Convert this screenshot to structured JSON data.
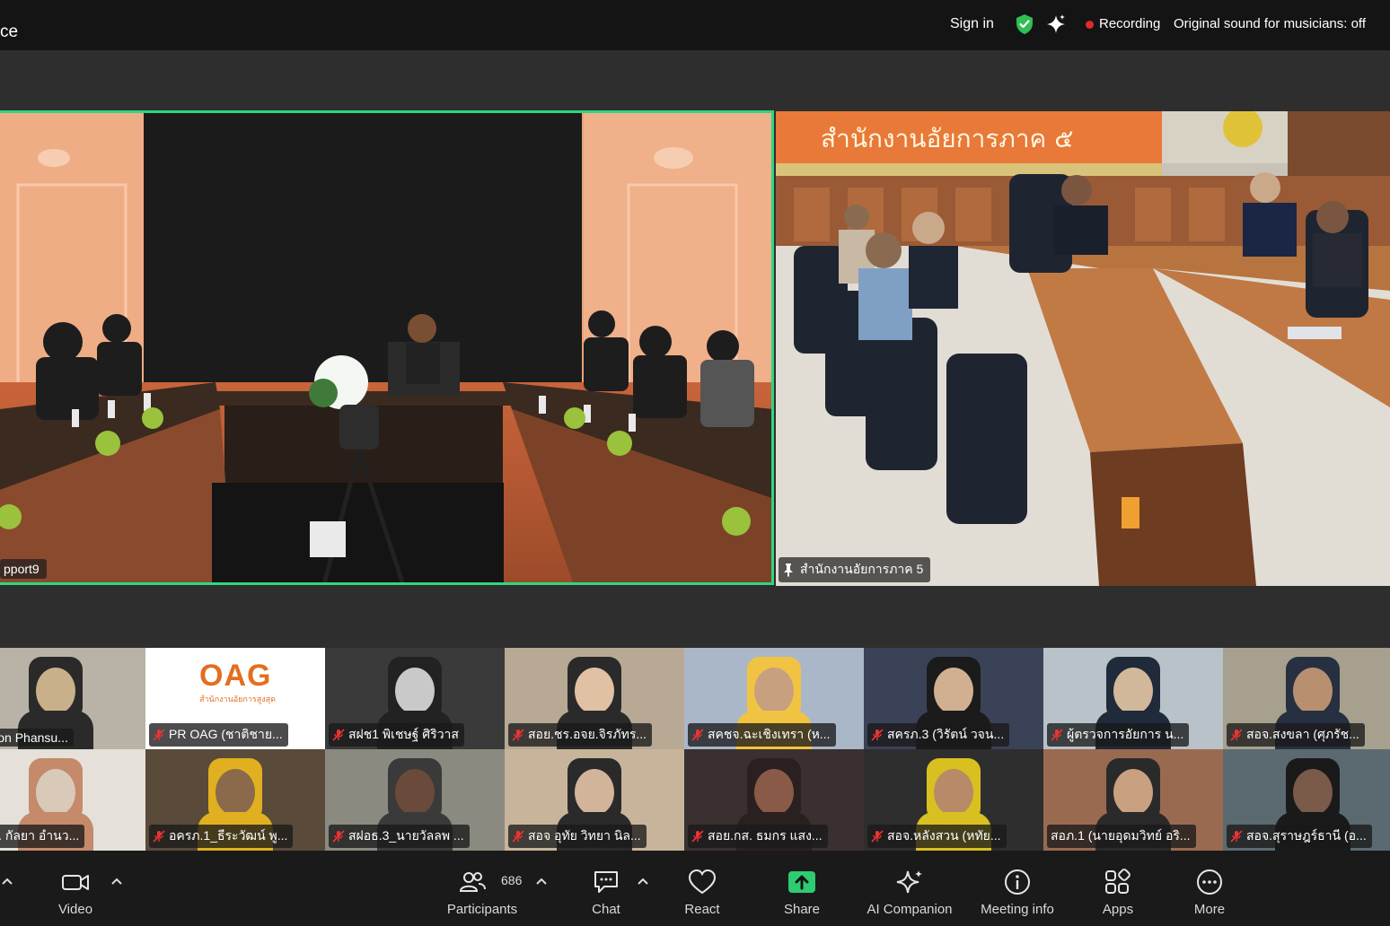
{
  "topbar": {
    "title_fragment": "ce",
    "sign_in": "Sign in",
    "recording": "Recording",
    "original_sound": "Original sound for musicians: off",
    "shield_color": "#2fbf52"
  },
  "main_video": {
    "name": "pport9",
    "border_color": "#2fd67f"
  },
  "right_video": {
    "name": "สำนักงานอัยการภาค 5",
    "banner": "สำนักงานอัยการภาค ๕"
  },
  "gallery": [
    {
      "label": "umpon Phansu...",
      "muted": false
    },
    {
      "label": "PR OAG (ชาติชาย...",
      "muted": true,
      "logo": "OAG",
      "logo_sub": "สำนักงานอัยการสูงสุด"
    },
    {
      "label": "สฝช1 พิเชษฐ์ ศิริวาส",
      "muted": true
    },
    {
      "label": "สอย.ชร.อจย.จิรภัทร...",
      "muted": true
    },
    {
      "label": "สคชจ.ฉะเชิงเทรา (ห...",
      "muted": true
    },
    {
      "label": "สครภ.3 (วิรัตน์ วจน...",
      "muted": true
    },
    {
      "label": "ผู้ตรวจการอัยการ น...",
      "muted": true
    },
    {
      "label": "สอจ.สงขลา (ศุภรัช...",
      "muted": true
    },
    {
      "label": "คพช. กัลยา อำนว...",
      "muted": false
    },
    {
      "label": "อครภ.1_ธีระวัฒน์ พู...",
      "muted": true
    },
    {
      "label": "สฝอธ.3_นายวัลลพ ...",
      "muted": true
    },
    {
      "label": "สอจ อุทัย วิทยา นิล...",
      "muted": true
    },
    {
      "label": "สอย.กส. ธมกร แสง...",
      "muted": true
    },
    {
      "label": "สอจ.หลังสวน (หทัย...",
      "muted": true
    },
    {
      "label": "สอภ.1 (นายอุดมวิทย์ อริ...",
      "muted": false
    },
    {
      "label": "สอจ.สุราษฎร์ธานี (อ...",
      "muted": true
    }
  ],
  "toolbar": {
    "video": "Video",
    "participants": "Participants",
    "participants_count": "686",
    "chat": "Chat",
    "react": "React",
    "share": "Share",
    "ai_companion": "AI Companion",
    "meeting_info": "Meeting info",
    "apps": "Apps",
    "more": "More",
    "share_color": "#2ecc71"
  }
}
